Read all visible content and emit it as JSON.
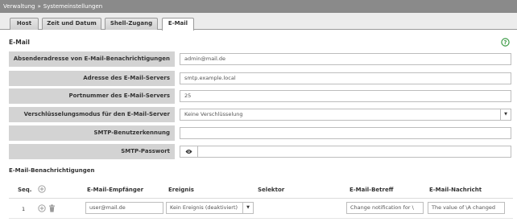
{
  "breadcrumb": {
    "part1": "Verwaltung",
    "separator": "»",
    "part2": "Systemeinstellungen"
  },
  "tabs": [
    {
      "label": "Host"
    },
    {
      "label": "Zeit und Datum"
    },
    {
      "label": "Shell-Zugang"
    },
    {
      "label": "E-Mail"
    }
  ],
  "section": {
    "title": "E-Mail"
  },
  "form": {
    "sender": {
      "label": "Absenderadresse von E-Mail-Benachrichtigungen",
      "value": "admin@mail.de"
    },
    "server": {
      "label": "Adresse des E-Mail-Servers",
      "value": "smtp.example.local"
    },
    "port": {
      "label": "Portnummer des E-Mail-Servers",
      "value": "25"
    },
    "encryption": {
      "label": "Verschlüsselungsmodus für den E-Mail-Server",
      "value": "Keine Verschlüsselung"
    },
    "user": {
      "label": "SMTP-Benutzerkennung",
      "value": ""
    },
    "password": {
      "label": "SMTP-Passwort",
      "value": ""
    }
  },
  "notifications": {
    "title": "E-Mail-Benachrichtigungen",
    "headers": {
      "seq": "Seq.",
      "recipient": "E-Mail-Empfänger",
      "event": "Ereignis",
      "selector": "Selektor",
      "subject": "E-Mail-Betreff",
      "message": "E-Mail-Nachricht"
    },
    "rows": [
      {
        "seq": "1",
        "recipient": "user@mail.de",
        "event": "Kein Ereignis (deaktiviert)",
        "subject": "Change notification for \\",
        "message": "The value of \\A changed"
      }
    ]
  },
  "colors": {
    "titlebar": "#8a8a8a",
    "label_bg": "#d3d3d3",
    "help_icon": "#3a9a44"
  },
  "icons": {
    "help": "help-circle-icon",
    "eye": "eye-icon",
    "add": "plus-circle-icon",
    "delete": "trash-icon",
    "dropdown": "triangle-down-icon"
  }
}
